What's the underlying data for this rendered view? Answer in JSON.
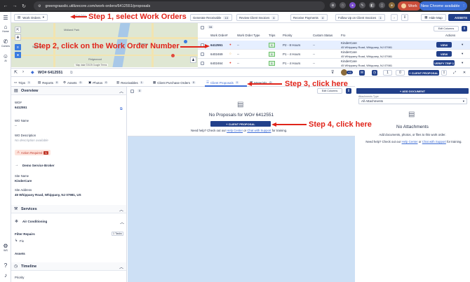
{
  "browser": {
    "url": "greengrasslic.utilizecore.com/work-orders/6412551/proposals",
    "profile_label": "Work",
    "chrome_available": "New Chrome available"
  },
  "rail": {
    "home": "Home",
    "comms": "Comms",
    "ai": "AI"
  },
  "header": {
    "workspace": "Work Orders",
    "schedule": "Schedule",
    "quick_buttons": [
      {
        "label": "Generate Receivable",
        "count": "13"
      },
      {
        "label": "Review Client Invoices",
        "count": "4"
      },
      {
        "label": "Receive Payments",
        "count": "4"
      },
      {
        "label": "Follow Up on Client Invoices",
        "count": "1"
      }
    ],
    "hide_map": "Hide Map",
    "assets": "ASSETS"
  },
  "map": {
    "footer": "Map data ©2025 Google   Terms",
    "labels": [
      "Midland Park",
      "Paramus",
      "Wyckoff",
      "Ridgewood"
    ]
  },
  "wo_table": {
    "count_badge": "34",
    "edit_columns": "Edit Columns",
    "headers": [
      "Work Order#",
      "Work Order Type",
      "Trips",
      "Priority",
      "Custom Status",
      "Fro",
      "Actions"
    ],
    "rows": [
      {
        "wo": "6412551",
        "type": "--",
        "trips": "1",
        "priority": "P2 - 8 Hours",
        "status": "--",
        "location": "KinderCare",
        "address": "45 Whippany Road, Whippany, NJ 07981",
        "action": "VIEW"
      },
      {
        "wo": "6402469",
        "type": "--",
        "trips": "1",
        "priority": "P1 - 4 Hours",
        "status": "--",
        "location": "KinderCare",
        "address": "45 Whippany Road, Whippany, NJ 07981",
        "action": "VIEW"
      },
      {
        "wo": "6402464",
        "type": "--",
        "trips": "1",
        "priority": "P1 - 4 Hours",
        "status": "--",
        "location": "KinderCare",
        "address": "45 Whippany Road, Whippany, NJ 07981",
        "action": "VERIFY TRIP 1"
      }
    ]
  },
  "detail": {
    "title": "WO# 6412551",
    "badge": "+3",
    "counts": [
      "1",
      "0"
    ],
    "add_proposal": "+ CLIENT PROPOSAL"
  },
  "tabs": [
    {
      "label": "Trips",
      "count": "1"
    },
    {
      "label": "Reports",
      "count": "0"
    },
    {
      "label": "Assets",
      "count": "0"
    },
    {
      "label": "Photos",
      "count": "0"
    },
    {
      "label": "Receivables",
      "count": "1"
    },
    {
      "label": "Client Purchase Orders",
      "count": "0"
    },
    {
      "label": "Client Proposals",
      "count": "0"
    },
    {
      "label": "Materials",
      "count": "0"
    }
  ],
  "overview": {
    "title": "Overview",
    "wo_label": "WO#",
    "wo_value": "6412551",
    "name_label": "WO Name",
    "name_value": "--",
    "desc_label": "WO Description",
    "desc_value": "No description available",
    "action_required": "Action Required",
    "action_count": "1",
    "broker": "Demo Service Broker",
    "site_name_label": "Site Name",
    "site_name_value": "KinderCare",
    "site_addr_label": "Site Address",
    "site_addr_value": "45 Whippany Road, Whippany, NJ 07981, US",
    "services_title": "Services",
    "service_name": "Air Conditioning",
    "service_task": "Filter Repairs",
    "service_task_badge": "1 Tasks",
    "service_sub": "Fix",
    "assets_label": "Assets",
    "timeline_title": "Timeline",
    "priority_label": "Priority"
  },
  "proposals": {
    "count": "0",
    "edit_columns": "Edit Columns",
    "empty_title": "No Proposals for WO# 6412551",
    "add_button": "+ CLIENT PROPOSAL",
    "help_prefix": "Need help? Check out our",
    "help_center": "Help Center",
    "help_or": "or",
    "chat_support": "Chat with Support",
    "help_suffix": "for training."
  },
  "attachments": {
    "add_button": "+ ADD DOCUMENT",
    "type_label": "Attachments Type",
    "type_value": "All Attachments",
    "empty_title": "No Attachments",
    "empty_desc": "Add documents, photos, or files to this work order.",
    "help_prefix": "Need help? Check out our",
    "help_center": "Help Center",
    "help_or": "or",
    "chat_support": "Chat with Support",
    "help_suffix": "for training."
  },
  "annotations": {
    "step1": "Step 1, select Work Orders",
    "step2": "Step 2, click on the Work Order Number",
    "step3": "Step 3, click here",
    "step4": "Step 4, click here"
  }
}
